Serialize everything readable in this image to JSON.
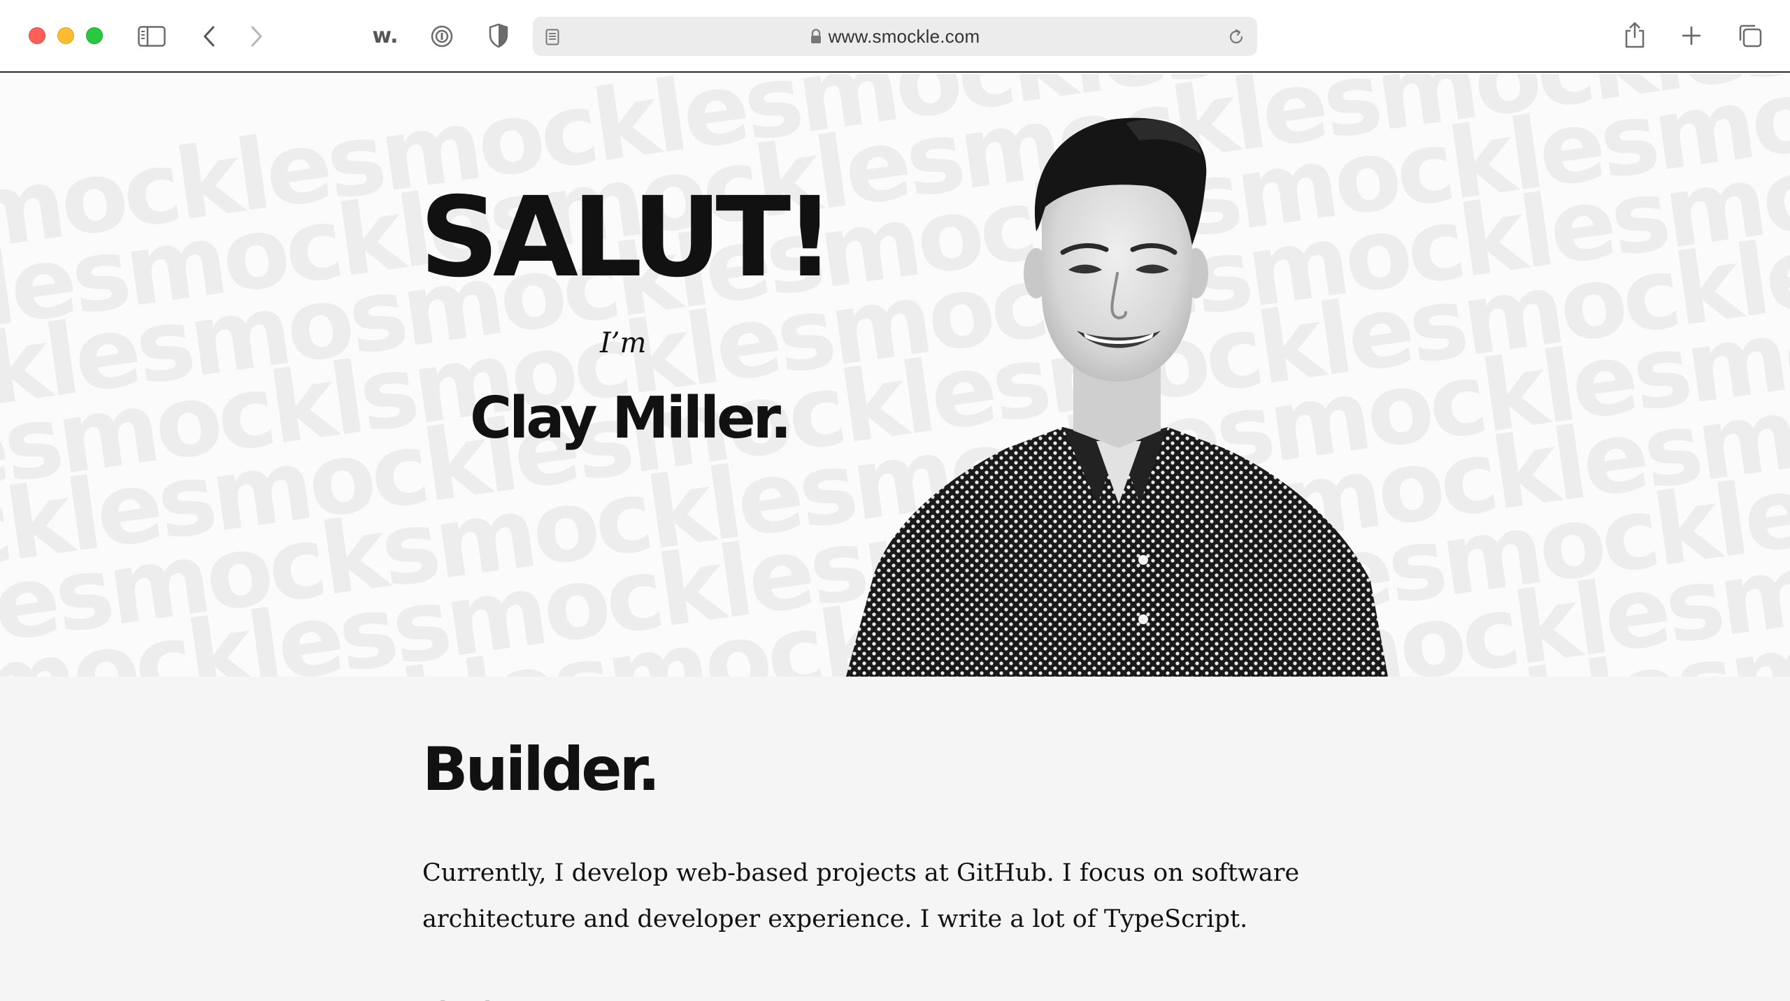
{
  "browser": {
    "url": "www.smockle.com",
    "toolbar_icons": [
      "sidebar-icon",
      "back-icon",
      "forward-icon",
      "w-extension-icon",
      "password-extension-icon",
      "shield-extension-icon",
      "reader-icon",
      "lock-icon",
      "reload-icon",
      "share-icon",
      "new-tab-icon",
      "tab-overview-icon"
    ],
    "w_extension_label": "w."
  },
  "hero": {
    "background_pattern_text": "smockle",
    "greeting": "SALUT!",
    "intro": "I’m",
    "name": "Clay Miller.",
    "portrait_alt": "Black and white photo of Clay Miller smiling, wearing a polka-dot shirt"
  },
  "content": {
    "heading": "Builder.",
    "paragraph": "Currently, I develop web-based projects at GitHub. I focus on software architecture and developer experience. I write a lot of TypeScript.",
    "next_paragraph_partial": "I lead..."
  },
  "colors": {
    "text": "#111111",
    "hero_bg": "#fbfbfb",
    "pattern": "#ededed",
    "content_bg": "#f5f5f5",
    "traffic_red": "#fe5f57",
    "traffic_yellow": "#febc2e",
    "traffic_green": "#28c840"
  }
}
